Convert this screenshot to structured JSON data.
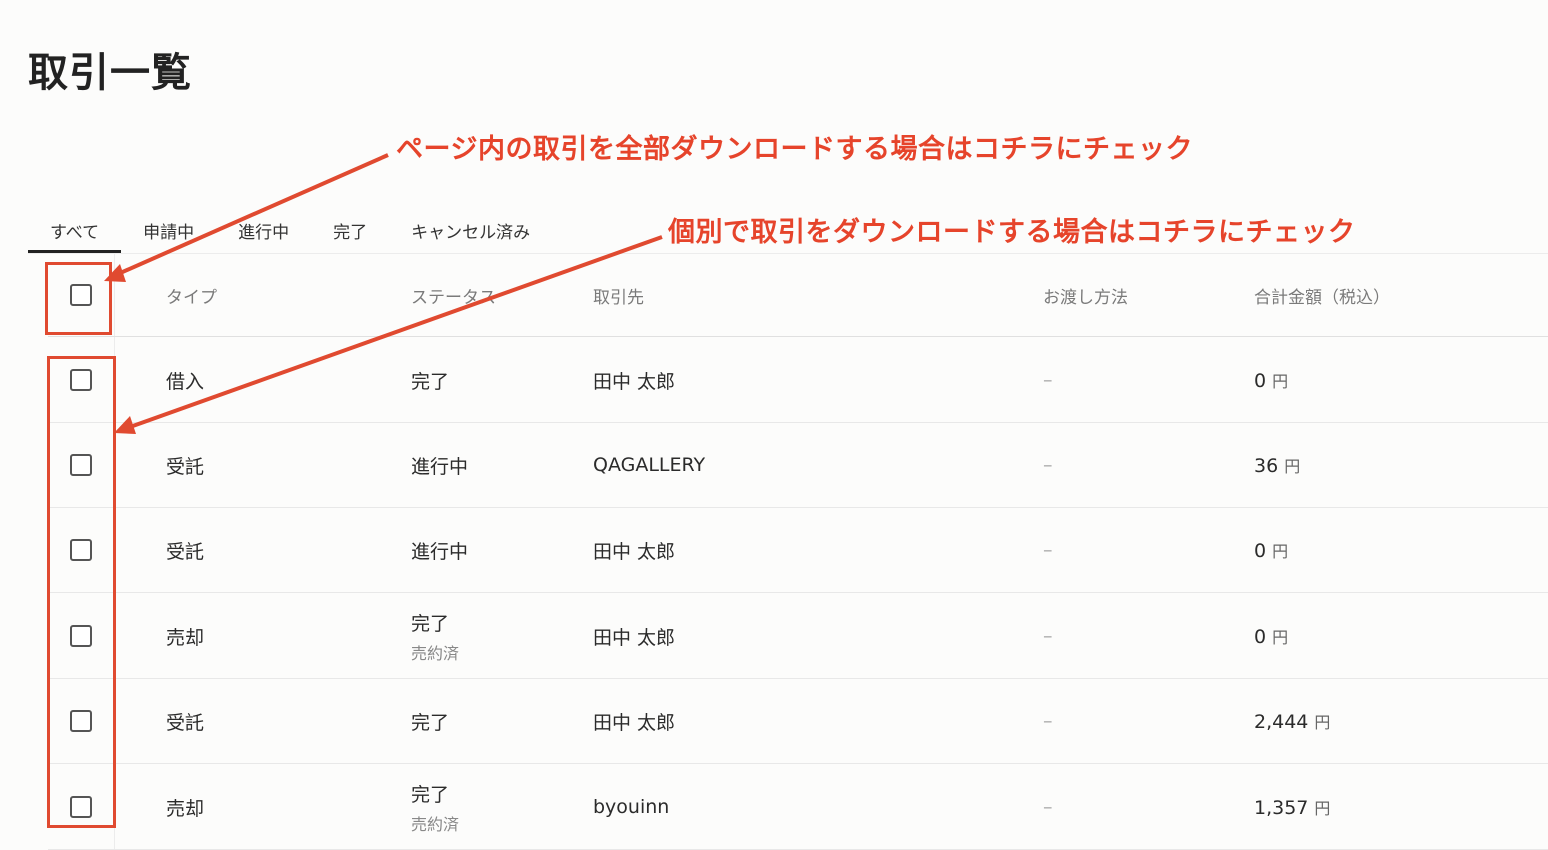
{
  "page": {
    "title": "取引一覧"
  },
  "tabs": [
    {
      "label": "すべて",
      "active": true
    },
    {
      "label": "申請中",
      "active": false
    },
    {
      "label": "進行中",
      "active": false
    },
    {
      "label": "完了",
      "active": false
    },
    {
      "label": "キャンセル済み",
      "active": false
    }
  ],
  "table": {
    "headers": {
      "type": "タイプ",
      "status": "ステータス",
      "partner": "取引先",
      "method": "お渡し方法",
      "total": "合計金額（税込）"
    },
    "rows": [
      {
        "type": "借入",
        "status": "完了",
        "substatus": "",
        "partner": "田中 太郎",
        "method": "–",
        "total": "0",
        "unit": "円"
      },
      {
        "type": "受託",
        "status": "進行中",
        "substatus": "",
        "partner": "QAGALLERY",
        "method": "–",
        "total": "36",
        "unit": "円"
      },
      {
        "type": "受託",
        "status": "進行中",
        "substatus": "",
        "partner": "田中 太郎",
        "method": "–",
        "total": "0",
        "unit": "円"
      },
      {
        "type": "売却",
        "status": "完了",
        "substatus": "売約済",
        "partner": "田中 太郎",
        "method": "–",
        "total": "0",
        "unit": "円"
      },
      {
        "type": "受託",
        "status": "完了",
        "substatus": "",
        "partner": "田中 太郎",
        "method": "–",
        "total": "2,444",
        "unit": "円"
      },
      {
        "type": "売却",
        "status": "完了",
        "substatus": "売約済",
        "partner": "byouinn",
        "method": "–",
        "total": "1,357",
        "unit": "円"
      }
    ]
  },
  "annotations": {
    "select_all": "ページ内の取引を全部ダウンロードする場合はコチラにチェック",
    "select_individual": "個別で取引をダウンロードする場合はコチラにチェック",
    "color": "#e6442b"
  }
}
